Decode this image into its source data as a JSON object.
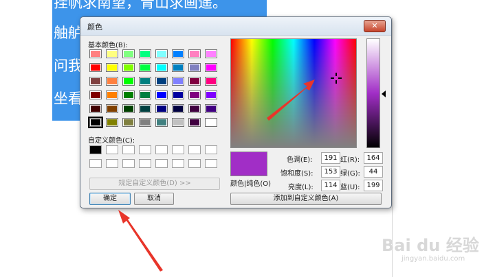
{
  "document": {
    "lines": [
      "挂帆求南望，青山求画遥。",
      "舳舻",
      "问我",
      "坐看"
    ]
  },
  "dialog": {
    "title": "颜色",
    "close_label": "✕",
    "basic_colors_label": "基本颜色(B):",
    "basic_colors": [
      [
        "#ff8080",
        "#ffff80",
        "#80ff80",
        "#00ff80",
        "#80ffff",
        "#0080ff",
        "#ff80c0",
        "#ff80ff"
      ],
      [
        "#ff0000",
        "#ffff00",
        "#80ff00",
        "#00ff40",
        "#00ffff",
        "#0080c0",
        "#8080c0",
        "#ff00ff"
      ],
      [
        "#804040",
        "#ff8040",
        "#00ff00",
        "#008080",
        "#004080",
        "#8080ff",
        "#800040",
        "#ff0080"
      ],
      [
        "#800000",
        "#ff8000",
        "#008000",
        "#008040",
        "#0000ff",
        "#0000a0",
        "#800080",
        "#8000ff"
      ],
      [
        "#400000",
        "#804000",
        "#004000",
        "#004040",
        "#000080",
        "#000040",
        "#400040",
        "#400080"
      ],
      [
        "#000000",
        "#808000",
        "#808040",
        "#808080",
        "#408080",
        "#c0c0c0",
        "#400040",
        "#ffffff"
      ]
    ],
    "selected_basic": "5-0",
    "custom_colors_label": "自定义颜色(C):",
    "define_custom_label": "规定自定义颜色(D) >>",
    "ok_label": "确定",
    "cancel_label": "取消",
    "preview_label": "颜色|纯色(O)",
    "preview_color": "#a12ec6",
    "fields": {
      "hue_label": "色调(E):",
      "hue": "191",
      "sat_label": "饱和度(S):",
      "sat": "153",
      "lum_label": "亮度(L):",
      "lum": "114",
      "red_label": "红(R):",
      "red": "164",
      "green_label": "绿(G):",
      "green": "44",
      "blue_label": "蓝(U):",
      "blue": "199"
    },
    "add_custom_label": "添加到自定义颜色(A)"
  },
  "watermark": {
    "brand": "Bai du 经验",
    "url": "jingyan.baidu.com"
  },
  "annotation_color": "#e8352a"
}
